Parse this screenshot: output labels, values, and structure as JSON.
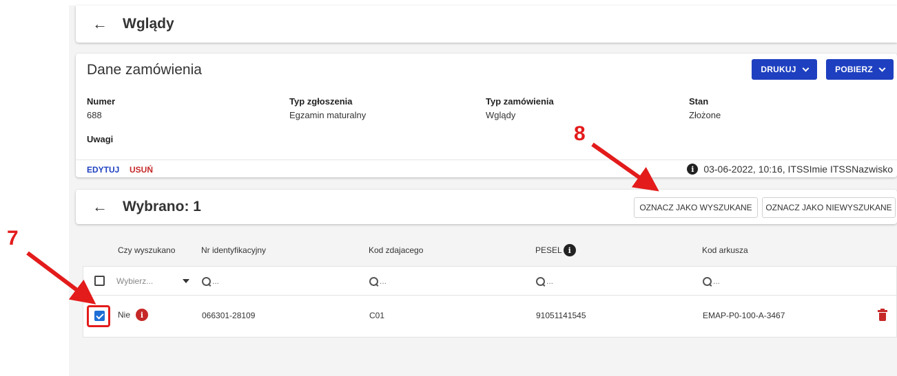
{
  "header": {
    "back_icon": "arrow-left-icon",
    "title": "Wglądy"
  },
  "order": {
    "title": "Dane zamówienia",
    "print_label": "DRUKUJ",
    "download_label": "POBIERZ",
    "fields": [
      {
        "label": "Numer",
        "value": "688"
      },
      {
        "label": "Typ zgłoszenia",
        "value": "Egzamin maturalny"
      },
      {
        "label": "Typ zamówienia",
        "value": "Wglądy"
      },
      {
        "label": "Stan",
        "value": "Złożone"
      }
    ],
    "notes_label": "Uwagi",
    "edit_label": "EDYTUJ",
    "delete_label": "USUŃ",
    "audit": "03-06-2022, 10:16, ITSSImie ITSSNazwisko"
  },
  "selection": {
    "title": "Wybrano: 1",
    "mark_found_label": "OZNACZ JAKO WYSZUKANE",
    "mark_not_found_label": "OZNACZ JAKO NIEWYSZUKANE"
  },
  "table": {
    "columns": [
      "Czy wyszukano",
      "Nr identyfikacyjny",
      "Kod zdajacego",
      "PESEL",
      "Kod arkusza"
    ],
    "filter_select_placeholder": "Wybierz...",
    "search_placeholder": "...",
    "rows": [
      {
        "found": "Nie",
        "id": "066301-28109",
        "code": "C01",
        "pesel": "91051141545",
        "sheet": "EMAP-P0-100-A-3467",
        "checked": true
      }
    ]
  },
  "annotations": {
    "step7": "7",
    "step8": "8"
  },
  "colors": {
    "primary": "#1e40c0",
    "danger": "#c62828",
    "annotation": "#e31b1b",
    "checkbox": "#1e6fd6"
  }
}
